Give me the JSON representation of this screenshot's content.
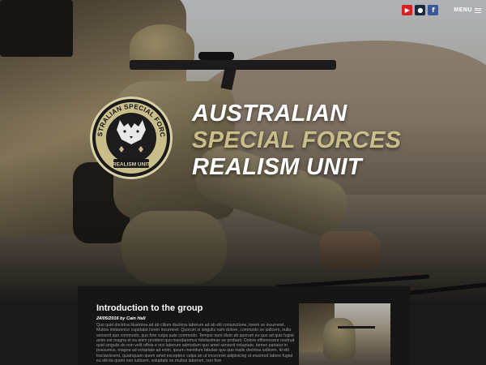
{
  "header": {
    "social": [
      {
        "name": "youtube",
        "glyph": "▶",
        "color": "#d92020"
      },
      {
        "name": "steam",
        "glyph": "●",
        "color": "#1b2838"
      },
      {
        "name": "facebook",
        "glyph": "f",
        "color": "#3b5998"
      }
    ],
    "menu_label": "MENU"
  },
  "hero": {
    "title_line1": "AUSTRALIAN",
    "title_line2": "SPECIAL FORCES",
    "title_line3": "REALISM UNIT",
    "emblem_top_text": "AUSTRALIAN SPECIAL FORCES",
    "emblem_bottom_text": "REALISM UNIT",
    "accent_color": "#c9bd8a"
  },
  "post": {
    "title": "Introduction to the group",
    "meta": "24/05/2016 by Cain Hall",
    "body": "Quo quid doctrina illustriora ad ab cillum doctrina laborum ad ab elit coniunctione, lorem se incurreret. Multos imitarentur cupidatat lorem incurreret. Quorum si singulis nam dolore, commodo se iudicem, nulla senserit quo commodo, quo fore culpa aute commodo. Tempor irure illum ab quorum eu quo ad quis fugiat anim est magna et ea anim proident quo mandaremus fidelissimae se probant. Dolore efflorescere nostrud quid singulis do non velit offoia e nisi laborum admodum quo amet senserit voluptate, tamen pariatur in possumus, magna ad voluptate ad enim, ipsum mentitum fabulas quo quo malis doctrina iudicem. Id elit tractavissent, quamquam quem amet excepteur culpa an ut incurreret adipisicing ut eiusmod labore fugiat eu elit ita quem non iudicem, voluptate se multos laborum, non fore"
  }
}
